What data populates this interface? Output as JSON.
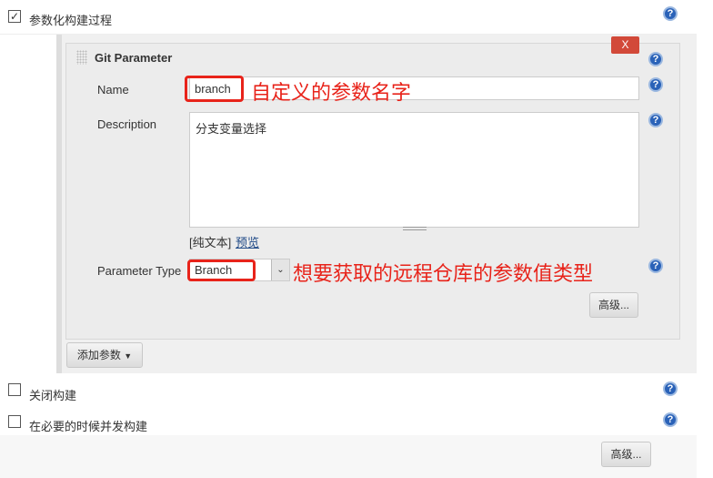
{
  "parameterized_build": {
    "label": "参数化构建过程",
    "checked": true
  },
  "git_parameter": {
    "title": "Git Parameter",
    "delete_label": "X",
    "name_label": "Name",
    "name_value": "branch",
    "description_label": "Description",
    "description_value": "分支变量选择",
    "plain_text": "[纯文本]",
    "preview_link": "预览",
    "parameter_type_label": "Parameter Type",
    "parameter_type_value": "Branch",
    "advanced_label": "高级..."
  },
  "annotations": {
    "name": "自定义的参数名字",
    "type": "想要获取的远程仓库的参数值类型"
  },
  "add_parameter_label": "添加参数",
  "disable_build": {
    "label": "关闭构建",
    "checked": false
  },
  "concurrent_build": {
    "label": "在必要的时候并发构建",
    "checked": false
  },
  "advanced_label": "高级...",
  "colors": {
    "annotation": "#e8231a",
    "help": "#2a62b8",
    "delete": "#d24939"
  }
}
